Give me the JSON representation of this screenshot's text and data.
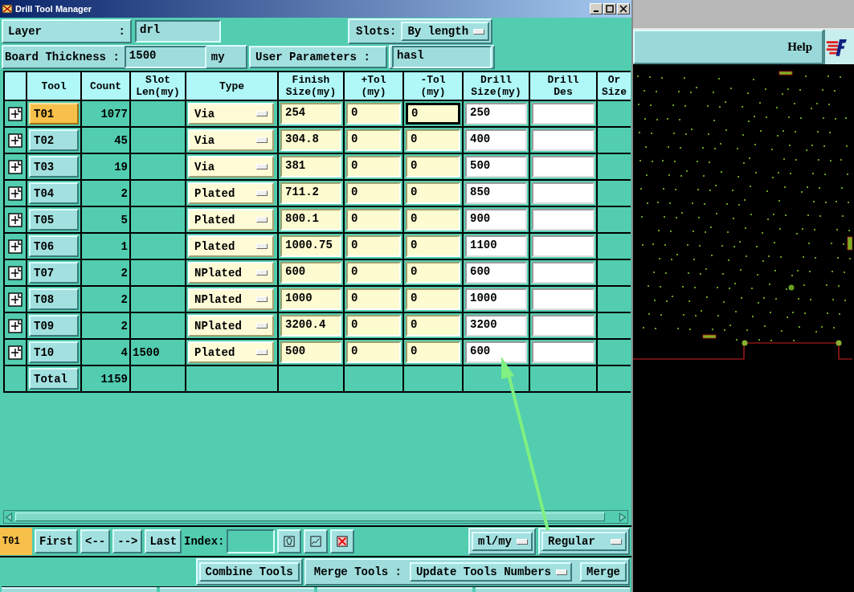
{
  "window": {
    "title": "Drill Tool Manager"
  },
  "layer": {
    "label": "Layer",
    "colon": ":",
    "value": "drl"
  },
  "slots": {
    "label": "Slots:",
    "value": "By length"
  },
  "board_thickness": {
    "label": "Board Thickness :",
    "value": "1500",
    "unit": "my"
  },
  "user_parameters": {
    "label": "User Parameters :",
    "value": "hasl"
  },
  "table": {
    "columns": [
      "Tool",
      "Count",
      "Slot\nLen(my)",
      "Type",
      "Finish\nSize(my)",
      "+Tol\n(my)",
      "-Tol\n(my)",
      "Drill\nSize(my)",
      "Drill\nDes",
      "Or\nSize"
    ],
    "rows": [
      {
        "tool": "T01",
        "selected": true,
        "count": "1077",
        "type": "Via",
        "finish": "254",
        "plus_tol": "0",
        "minus_tol": "0",
        "drill_size": "250"
      },
      {
        "tool": "T02",
        "selected": false,
        "count": "45",
        "type": "Via",
        "finish": "304.8",
        "plus_tol": "0",
        "minus_tol": "0",
        "drill_size": "400"
      },
      {
        "tool": "T03",
        "selected": false,
        "count": "19",
        "type": "Via",
        "finish": "381",
        "plus_tol": "0",
        "minus_tol": "0",
        "drill_size": "500"
      },
      {
        "tool": "T04",
        "selected": false,
        "count": "2",
        "type": "Plated",
        "finish": "711.2",
        "plus_tol": "0",
        "minus_tol": "0",
        "drill_size": "850"
      },
      {
        "tool": "T05",
        "selected": false,
        "count": "5",
        "type": "Plated",
        "finish": "800.1",
        "plus_tol": "0",
        "minus_tol": "0",
        "drill_size": "900"
      },
      {
        "tool": "T06",
        "selected": false,
        "count": "1",
        "type": "Plated",
        "finish": "1000.75",
        "plus_tol": "0",
        "minus_tol": "0",
        "drill_size": "1100"
      },
      {
        "tool": "T07",
        "selected": false,
        "count": "2",
        "type": "NPlated",
        "finish": "600",
        "plus_tol": "0",
        "minus_tol": "0",
        "drill_size": "600"
      },
      {
        "tool": "T08",
        "selected": false,
        "count": "2",
        "type": "NPlated",
        "finish": "1000",
        "plus_tol": "0",
        "minus_tol": "0",
        "drill_size": "1000"
      },
      {
        "tool": "T09",
        "selected": false,
        "count": "2",
        "type": "NPlated",
        "finish": "3200.4",
        "plus_tol": "0",
        "minus_tol": "0",
        "drill_size": "3200"
      },
      {
        "tool": "T10",
        "selected": false,
        "count": "4",
        "slot_len": "1500",
        "type": "Plated",
        "finish": "500",
        "plus_tol": "0",
        "minus_tol": "0",
        "drill_size": "600"
      }
    ],
    "total": {
      "label": "Total",
      "count": "1159"
    }
  },
  "navigation": {
    "current": "T01",
    "buttons": [
      "First",
      "<--",
      "-->",
      "Last"
    ],
    "index_label": "Index:",
    "units": "ml/my",
    "mode": "Regular"
  },
  "merge_bar": {
    "combine": "Combine Tools",
    "merge_label": "Merge Tools :",
    "merge_mode": "Update Tools Numbers",
    "merge": "Merge"
  },
  "viewer": {
    "help": "Help"
  }
}
